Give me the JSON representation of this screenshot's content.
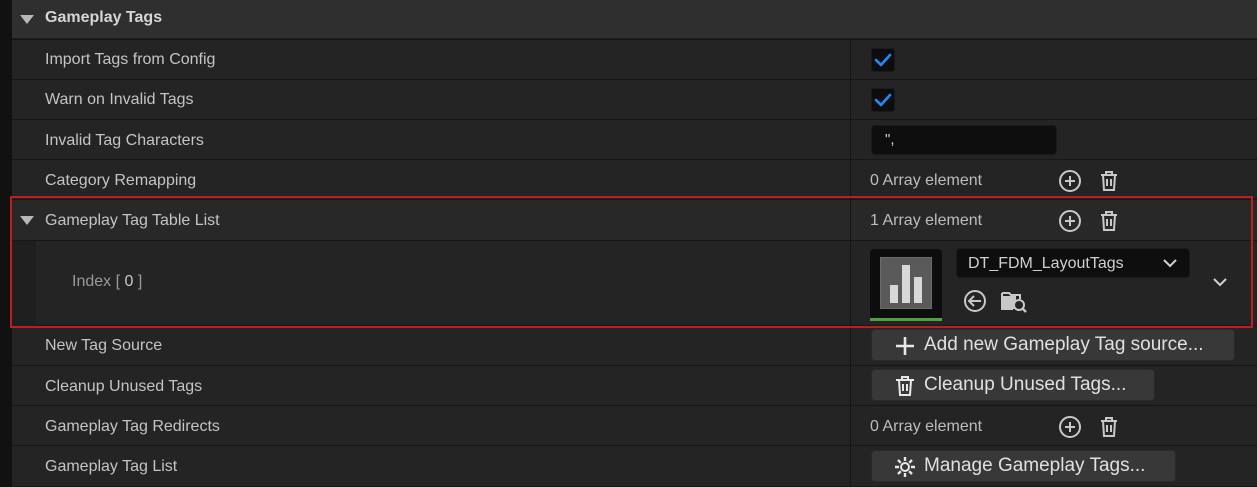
{
  "section": {
    "title": "Gameplay Tags"
  },
  "rows": {
    "import_tags": {
      "label": "Import Tags from Config",
      "checked": true
    },
    "warn_invalid": {
      "label": "Warn on Invalid Tags",
      "checked": true
    },
    "invalid_chars": {
      "label": "Invalid Tag Characters",
      "value": "\",",
      "placeholder": ""
    },
    "category_remap": {
      "label": "Category Remapping",
      "count_text": "0 Array element"
    },
    "table_list": {
      "label": "Gameplay Tag Table List",
      "count_text": "1 Array element",
      "index_prefix": "Index [",
      "index_value": "0",
      "index_suffix": "]",
      "asset_name": "DT_FDM_LayoutTags"
    },
    "new_source": {
      "label": "New Tag Source",
      "button_label": "Add new Gameplay Tag source..."
    },
    "cleanup": {
      "label": "Cleanup Unused Tags",
      "button_label": "Cleanup Unused Tags..."
    },
    "redirects": {
      "label": "Gameplay Tag Redirects",
      "count_text": "0 Array element"
    },
    "tag_list": {
      "label": "Gameplay Tag List",
      "button_label": "Manage Gameplay Tags..."
    }
  },
  "icons": {
    "check": "checkmark-icon",
    "add": "add-circle-icon",
    "delete": "trash-icon",
    "browse": "browse-asset-icon",
    "use_selected": "use-selected-arrow-icon",
    "expand": "chevron-down-icon",
    "settings": "gear-icon"
  },
  "colors": {
    "checkmark": "#1a8cff",
    "highlight": "#c11d1d",
    "thumb_accent": "#4aa63a"
  }
}
